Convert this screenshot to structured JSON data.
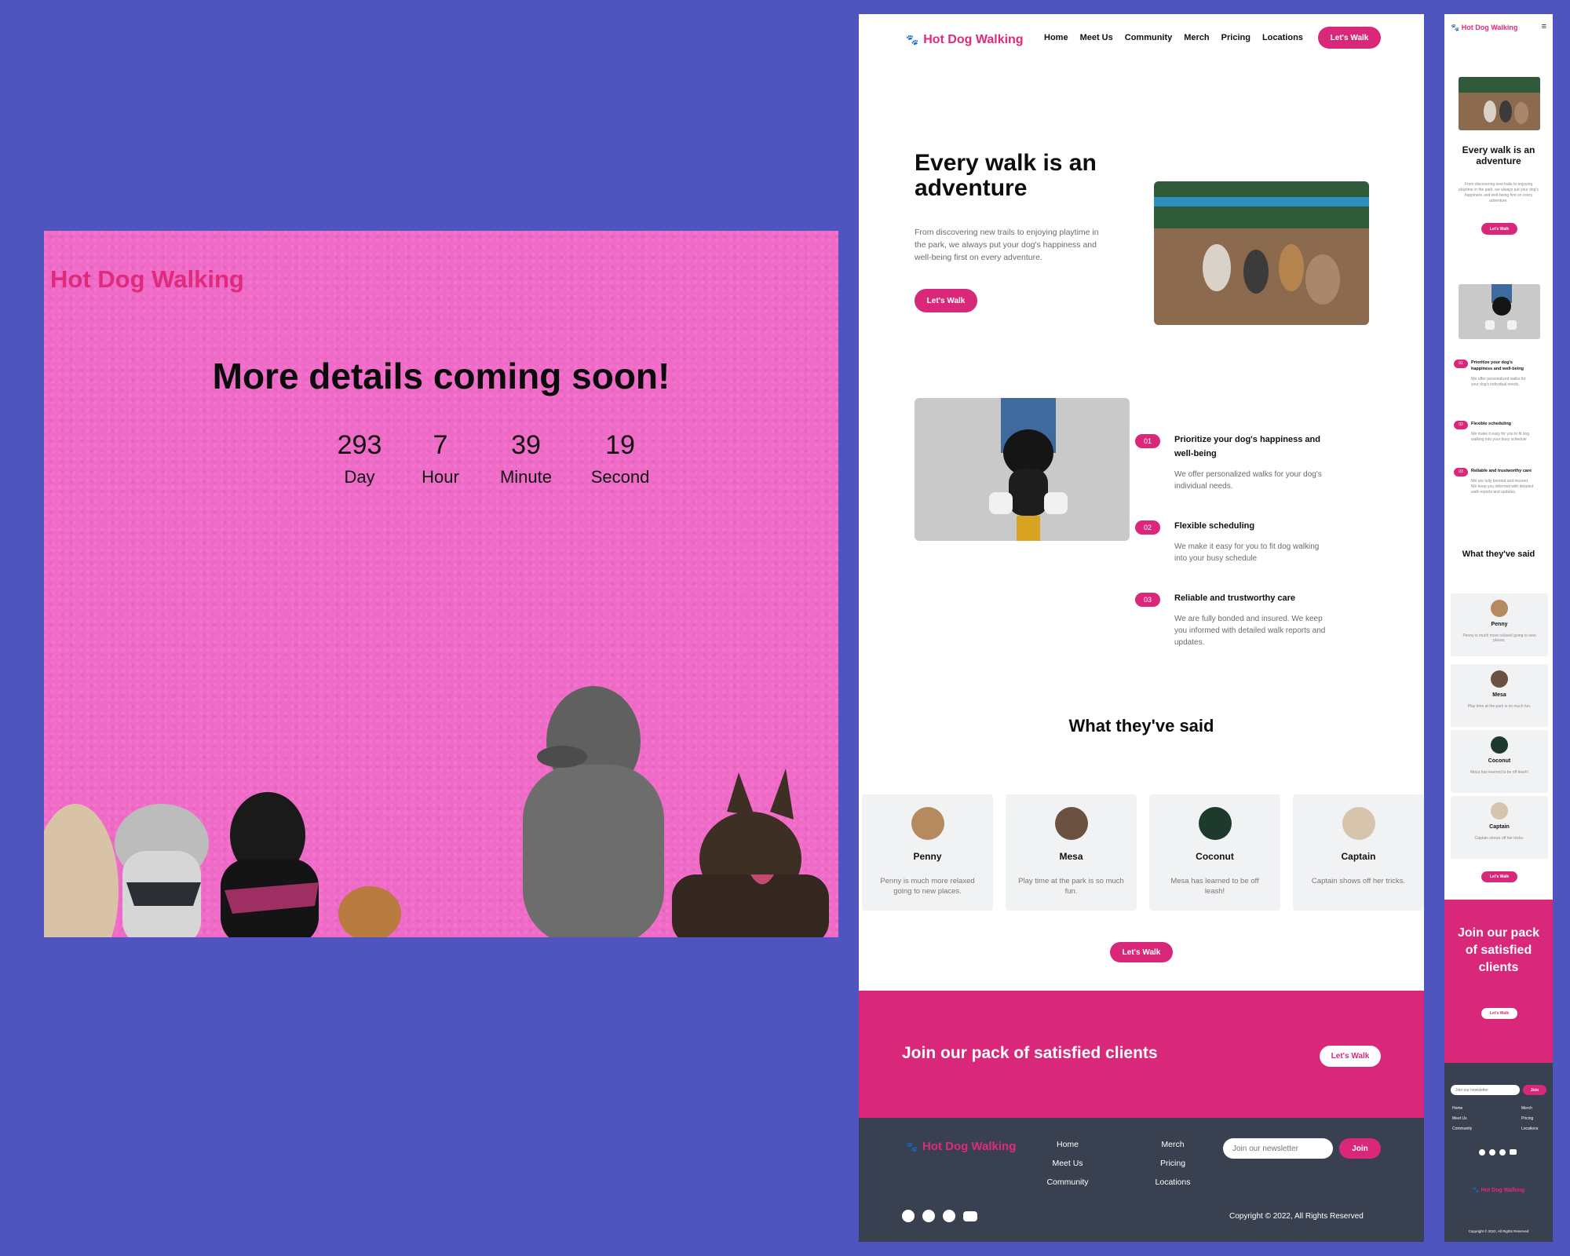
{
  "countdown": {
    "logo": "Hot Dog Walking",
    "heading": "More details coming soon!",
    "units": [
      {
        "value": "293",
        "label": "Day"
      },
      {
        "value": "7",
        "label": "Hour"
      },
      {
        "value": "39",
        "label": "Minute"
      },
      {
        "value": "19",
        "label": "Second"
      }
    ]
  },
  "desktop": {
    "nav": {
      "logo": "Hot Dog Walking",
      "links": [
        "Home",
        "Meet Us",
        "Community",
        "Merch",
        "Pricing",
        "Locations"
      ],
      "cta": "Let's Walk"
    },
    "hero": {
      "title": "Every walk is an adventure",
      "text": "From discovering new trails to enjoying playtime in the park, we always put your dog's happiness and well-being first on every adventure.",
      "cta": "Let's Walk"
    },
    "features": [
      {
        "num": "01",
        "title": "Prioritize your dog's happiness and well-being",
        "desc": "We offer personalized walks for your dog's individual needs."
      },
      {
        "num": "02",
        "title": "Flexible scheduling",
        "desc": "We make it easy for you to fit dog walking into your busy schedule"
      },
      {
        "num": "03",
        "title": "Reliable and trustworthy care",
        "desc": "We are fully bonded and insured. We keep you informed with detailed walk reports and updates."
      }
    ],
    "testimonials_title": "What they've said",
    "testimonials": [
      {
        "name": "Penny",
        "quote": "Penny is much more relaxed going to new places."
      },
      {
        "name": "Mesa",
        "quote": "Play time at the park is so much fun."
      },
      {
        "name": "Coconut",
        "quote": "Mesa has learned to be off leash!"
      },
      {
        "name": "Captain",
        "quote": "Captain shows off her tricks."
      }
    ],
    "testimonials_cta": "Let's Walk",
    "join": {
      "title": "Join our pack of satisfied clients",
      "cta": "Let's Walk"
    },
    "footer": {
      "logo": "Hot Dog Walking",
      "col1": [
        "Home",
        "Meet Us",
        "Community"
      ],
      "col2": [
        "Merch",
        "Pricing",
        "Locations"
      ],
      "newsletter_placeholder": "Join our newsletter",
      "join_btn": "Join",
      "copyright": "Copyright © 2022, All Rights Reserved"
    }
  },
  "mobile": {
    "logo": "Hot Dog Walking",
    "hero_title": "Every walk is an adventure",
    "hero_text": "From discovering new trails to enjoying playtime in the park, we always put your dog's happiness and well-being first on every adventure.",
    "cta": "Let's Walk",
    "features": [
      {
        "num": "01",
        "title": "Prioritize your dog's happiness and well-being",
        "desc": "We offer personalized walks for your dog's individual needs."
      },
      {
        "num": "02",
        "title": "Flexible scheduling",
        "desc": "We make it easy for you to fit dog walking into your busy schedule"
      },
      {
        "num": "03",
        "title": "Reliable and trustworthy care",
        "desc": "We are fully bonded and insured. We keep you informed with detailed walk reports and updates."
      }
    ],
    "testimonials_title": "What they've said",
    "testimonials": [
      {
        "name": "Penny",
        "quote": "Penny is much more relaxed going to new places."
      },
      {
        "name": "Mesa",
        "quote": "Play time at the park is so much fun."
      },
      {
        "name": "Coconut",
        "quote": "Mesa has learned to be off leash!"
      },
      {
        "name": "Captain",
        "quote": "Captain shows off her tricks."
      }
    ],
    "join_title": "Join our pack of satisfied clients",
    "newsletter_placeholder": "Join our newsletter",
    "join_btn": "Join",
    "footer_col1": [
      "Home",
      "Meet Us",
      "Community"
    ],
    "footer_col2": [
      "Merch",
      "Pricing",
      "Locations"
    ],
    "footer_logo": "Hot Dog Walking",
    "copyright": "Copyright © 2022, All Rights Reserved"
  },
  "colors": {
    "background": "#5054bf",
    "brand": "#d9287a",
    "countdown_bg": "#f06bc8",
    "footer": "#394050"
  }
}
